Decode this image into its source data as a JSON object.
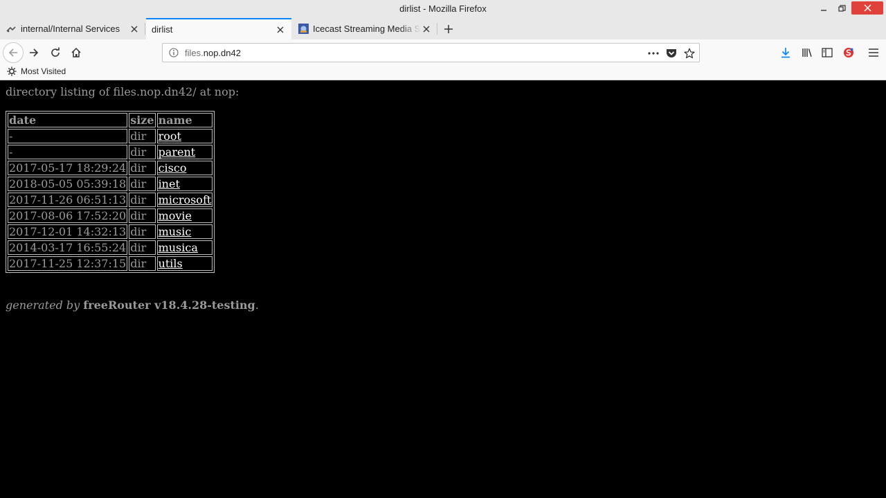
{
  "window": {
    "title": "dirlist - Mozilla Firefox"
  },
  "tabs": [
    {
      "label": "internal/Internal Services",
      "favicon": "router-icon",
      "active": false
    },
    {
      "label": "dirlist",
      "favicon": "none",
      "active": true
    },
    {
      "label": "Icecast Streaming Media Server",
      "favicon": "icecast-icon",
      "active": false
    }
  ],
  "navbar": {
    "url_prefix": "files.",
    "url_domain": "nop.dn42"
  },
  "bookmarks": {
    "most_visited": "Most Visited"
  },
  "page": {
    "heading": "directory listing of files.nop.dn42/ at nop:",
    "columns": {
      "date": "date",
      "size": "size",
      "name": "name"
    },
    "rows": [
      {
        "date": "-",
        "size": "dir",
        "name": "root"
      },
      {
        "date": "-",
        "size": "dir",
        "name": "parent"
      },
      {
        "date": "2017-05-17 18:29:24",
        "size": "dir",
        "name": "cisco"
      },
      {
        "date": "2018-05-05 05:39:18",
        "size": "dir",
        "name": "inet"
      },
      {
        "date": "2017-11-26 06:51:13",
        "size": "dir",
        "name": "microsoft"
      },
      {
        "date": "2017-08-06 17:52:20",
        "size": "dir",
        "name": "movie"
      },
      {
        "date": "2017-12-01 14:32:13",
        "size": "dir",
        "name": "music"
      },
      {
        "date": "2014-03-17 16:55:24",
        "size": "dir",
        "name": "musica"
      },
      {
        "date": "2017-11-25 12:37:15",
        "size": "dir",
        "name": "utils"
      }
    ],
    "footer": {
      "generated_by": "generated by",
      "product": "freeRouter v18.4.28-testing",
      "period": "."
    }
  },
  "colors": {
    "accent": "#0a84ff",
    "page_background": "#000000",
    "page_text": "#9a9a9a",
    "link": "#ffffff",
    "close_button": "#e0413b"
  }
}
